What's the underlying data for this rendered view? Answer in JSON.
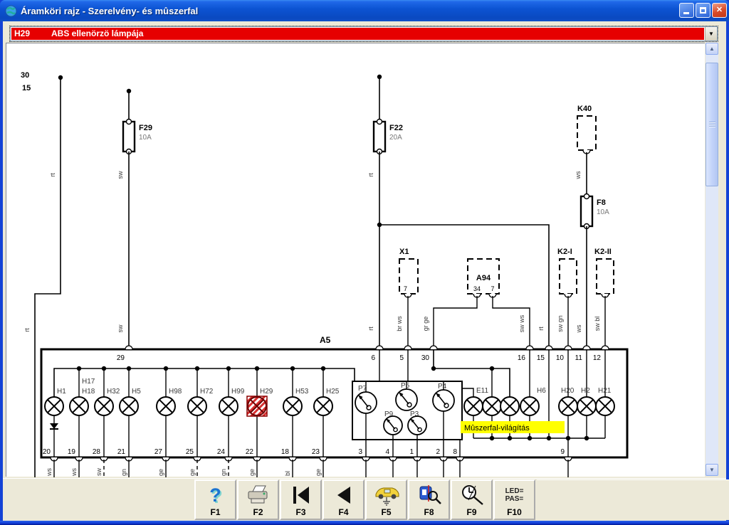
{
  "window": {
    "title": "Áramköri rajz - Szerelvény- és mûszerfal"
  },
  "selector": {
    "code": "H29",
    "label": "ABS ellenörzö lámpája"
  },
  "diagram": {
    "supply": {
      "line30": "30",
      "line15": "15"
    },
    "module": {
      "id": "A5"
    },
    "relay": {
      "id": "K40"
    },
    "fuses": [
      {
        "id": "F29",
        "rating": "10A"
      },
      {
        "id": "F22",
        "rating": "20A"
      },
      {
        "id": "F8",
        "rating": "10A"
      }
    ],
    "connectors": [
      {
        "id": "X1",
        "pins": [
          "7"
        ]
      },
      {
        "id": "A94",
        "pins": [
          "34",
          "7"
        ]
      },
      {
        "id": "K2-I",
        "pins": []
      },
      {
        "id": "K2-II",
        "pins": []
      }
    ],
    "lamps": [
      {
        "id": "H1"
      },
      {
        "id": "H17"
      },
      {
        "id": "H18"
      },
      {
        "id": "H32"
      },
      {
        "id": "H5"
      },
      {
        "id": "H98"
      },
      {
        "id": "H72"
      },
      {
        "id": "H99"
      },
      {
        "id": "H29"
      },
      {
        "id": "H53"
      },
      {
        "id": "H25"
      },
      {
        "id": "E11"
      },
      {
        "id": "H6"
      },
      {
        "id": "H20"
      },
      {
        "id": "H2"
      },
      {
        "id": "H21"
      }
    ],
    "gauges": [
      "P7",
      "P5",
      "P4",
      "P9",
      "P3"
    ],
    "top_terminals": [
      "29",
      "6",
      "5",
      "30",
      "16",
      "15",
      "10",
      "11",
      "12"
    ],
    "bottom_terminals": [
      "20",
      "19",
      "28",
      "21",
      "27",
      "25",
      "24",
      "22",
      "18",
      "23",
      "3",
      "4",
      "1",
      "2",
      "8",
      "9"
    ],
    "wire_labels": [
      "rt",
      "sw",
      "rt",
      "ws",
      "rt",
      "sw",
      "rt",
      "br ws",
      "gr ge",
      "sw ws",
      "rt",
      "sw gn",
      "ws",
      "sw bl"
    ],
    "stub_labels": [
      "ws",
      "ws",
      "sw",
      "gn",
      "ge",
      "ge",
      "gn",
      "ge",
      "bl",
      "ge"
    ],
    "note": {
      "text": "Mûszerfal-világítás"
    },
    "highlighted": "H29"
  },
  "toolbar": {
    "buttons": [
      {
        "key": "F1",
        "icon": "help-icon"
      },
      {
        "key": "F2",
        "icon": "print-icon"
      },
      {
        "key": "F3",
        "icon": "first-page-icon"
      },
      {
        "key": "F4",
        "icon": "previous-icon"
      },
      {
        "key": "F5",
        "icon": "car-location-icon"
      },
      {
        "key": "F8",
        "icon": "component-search-icon"
      },
      {
        "key": "F9",
        "icon": "target-search-icon"
      },
      {
        "key": "F10",
        "icon": "led-pas-icon",
        "line1": "LED=",
        "line2": "PAS="
      }
    ]
  }
}
